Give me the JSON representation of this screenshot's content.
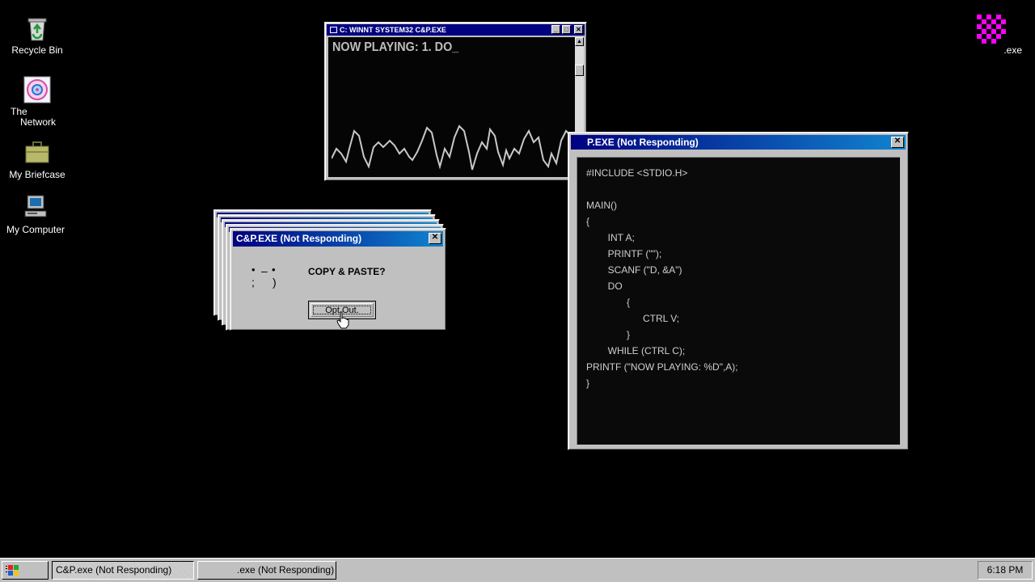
{
  "desktop": {
    "icons": [
      {
        "label": "Recycle Bin"
      },
      {
        "label_line1": "The",
        "label_line2": "Network"
      },
      {
        "label": "My Briefcase"
      },
      {
        "label": "My Computer"
      },
      {
        "label": ".exe"
      }
    ]
  },
  "console_window": {
    "title": "C: WINNT SYSTEM32 C&P.EXE",
    "text": "NOW PLAYING: 1. DO_"
  },
  "code_window": {
    "title": "P.EXE (Not Responding)",
    "code": "#INCLUDE <STDIO.H>\n\nMAIN()\n{\n        INT A;\n        PRINTF (\"\");\n        SCANF (\"D, &A\")\n        DO\n               {\n                     CTRL V;\n               }\n        WHILE (CTRL C);\nPRINTF (\"NOW PLAYING: %D\",A);\n}"
  },
  "dialog": {
    "title": "C&P.EXE (Not Responding)",
    "message": "COPY & PASTE?",
    "button": "Opt Out."
  },
  "taskbar": {
    "task1": "C&P.exe (Not Responding)",
    "task2": ".exe (Not Responding)",
    "clock": "6:18 PM"
  },
  "colors": {
    "desktop": "#000000",
    "titlebar": "#000080",
    "accent_icon": "#ff00ff"
  }
}
